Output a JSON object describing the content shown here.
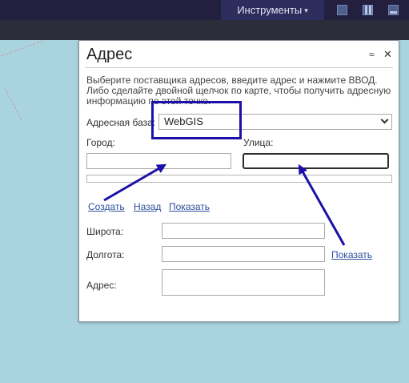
{
  "topbar": {
    "tools_menu_label": "Инструменты",
    "tools_menu_caret": "▾",
    "icons": [
      "square-view-icon",
      "split-view-icon",
      "bottom-panel-icon"
    ]
  },
  "dialog": {
    "title": "Адрес",
    "collapse_glyph": "≈",
    "close_glyph": "✕",
    "instructions": "Выберите поставщика адресов, введите адрес и нажмите ВВОД. Либо сделайте двойной щелчок по карте, чтобы получить адресную информацию по этой точке.",
    "address_base_label": "Адресная база:",
    "address_base_value": "WebGIS",
    "city_label": "Город:",
    "city_value": "",
    "street_label": "Улица:",
    "street_value": "",
    "progress_fraction": 0,
    "links": {
      "create": "Создать",
      "back": "Назад",
      "show": "Показать",
      "show_coords": "Показать"
    },
    "latitude_label": "Широта:",
    "latitude_value": "",
    "longitude_label": "Долгота:",
    "longitude_value": "",
    "address_label": "Адрес:",
    "address_value": ""
  },
  "colors": {
    "map_background": "#a9d3de",
    "topbar": "#23203f",
    "annotation": "#1b11a6",
    "link": "#2d4f9e"
  }
}
